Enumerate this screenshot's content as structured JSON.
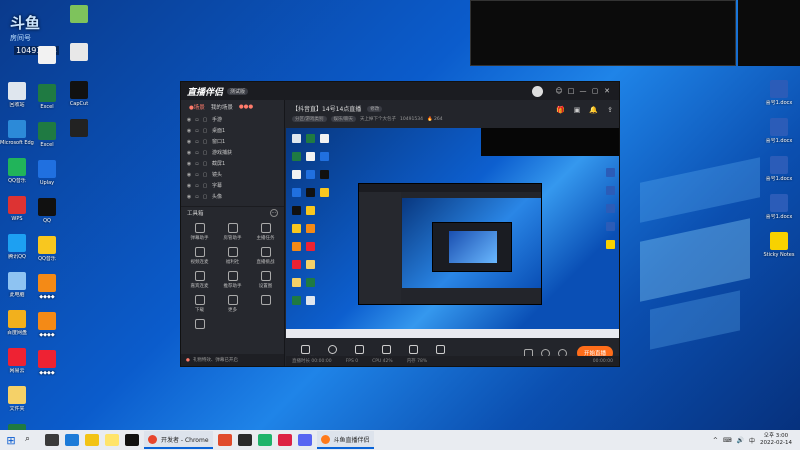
{
  "overlay": {
    "logo": "斗鱼",
    "sub": "房间号",
    "room_id": "10491534"
  },
  "desktop_icons_left": [
    {
      "label": "回收站",
      "color": "#dfe6ee"
    },
    {
      "label": "Microsoft Edge",
      "color": "#2c8ad8"
    },
    {
      "label": "QQ音乐",
      "color": "#21b45a"
    },
    {
      "label": "WPS",
      "color": "#d33"
    },
    {
      "label": "腾讯QQ",
      "color": "#1da0f2"
    },
    {
      "label": "此电脑",
      "color": "#8ec3f2"
    },
    {
      "label": "百度网盘",
      "color": "#f2b01d"
    },
    {
      "label": "网易云",
      "color": "#e23"
    },
    {
      "label": "文件夹",
      "color": "#f5d168"
    },
    {
      "label": "Excel",
      "color": "#1f7a42"
    }
  ],
  "desktop_icons_col2": [
    {
      "label": "",
      "color": "#f2f2f2"
    },
    {
      "label": "Excel",
      "color": "#1f7a42"
    },
    {
      "label": "Excel",
      "color": "#1f7a42"
    },
    {
      "label": "Uplay",
      "color": "#2070e0"
    },
    {
      "label": "QQ",
      "color": "#111"
    },
    {
      "label": "QQ音乐",
      "color": "#f8c71f"
    },
    {
      "label": "◆◆◆◆",
      "color": "#f48a16"
    },
    {
      "label": "◆◆◆◆",
      "color": "#f48a16"
    },
    {
      "label": "◆◆◆◆",
      "color": "#e23"
    }
  ],
  "desktop_icons_col3": [
    {
      "label": "",
      "color": "#7ec35c"
    },
    {
      "label": "",
      "color": "#e8e8e8"
    },
    {
      "label": "CapCut",
      "color": "#111"
    },
    {
      "label": "",
      "color": "#222"
    }
  ],
  "desktop_icons_right": [
    {
      "label": "喜号1.docx",
      "color": "#2b5cb8"
    },
    {
      "label": "喜号1.docx",
      "color": "#2b5cb8"
    },
    {
      "label": "喜号1.docx",
      "color": "#2b5cb8"
    },
    {
      "label": "喜号1.docx",
      "color": "#2b5cb8"
    },
    {
      "label": "Sticky Notes",
      "color": "#f7d200"
    }
  ],
  "app": {
    "title": "直播伴侣",
    "version": "测试版",
    "window_buttons": [
      "☺",
      "□",
      "—",
      "▢",
      "✕"
    ],
    "scene_tabs": [
      "●场景",
      "我的场景",
      "●●●"
    ],
    "sources": [
      "手游",
      "桌面1",
      "窗口1",
      "游戏捕获",
      "截屏1",
      "镜头",
      "字幕",
      "头像"
    ],
    "tools_title": "工具箱",
    "tools": [
      "弹幕助手",
      "房管助手",
      "主播任务",
      "视频连麦",
      "福利社",
      "直播挑战",
      "嘉宾连麦",
      "推荐助手",
      "设置图",
      "下载",
      "更多",
      "",
      ""
    ],
    "left_footer": "礼物特效、弹幕已开启",
    "room_title": "【抖音直】14号14点直播",
    "room_tag": "修改",
    "room_meta": [
      "分区/游戏类别",
      "娱乐/聊天",
      "天上掉下个大包子",
      "10491534",
      "🔥 264"
    ],
    "bottom_buttons": [
      "直播屏幕",
      "摄像头",
      "手机投屏",
      "多媒体",
      "麦克风",
      "扬声器"
    ],
    "go_live": "开始直播",
    "status": [
      "直播时长 00:00:00",
      "FPS 0",
      "CPU 42%",
      "内存 78%"
    ],
    "time": "00:00:00"
  },
  "taskbar": {
    "apps": [
      {
        "label": "开发者 - Chrome",
        "color": "#e7452d"
      },
      {
        "label": "斗鱼直播伴侣",
        "color": "#ff7a1a"
      }
    ],
    "tray": [
      "^",
      "⌨",
      "🔊",
      "中"
    ],
    "time": "오후 3:00",
    "date": "2022-02-14"
  }
}
